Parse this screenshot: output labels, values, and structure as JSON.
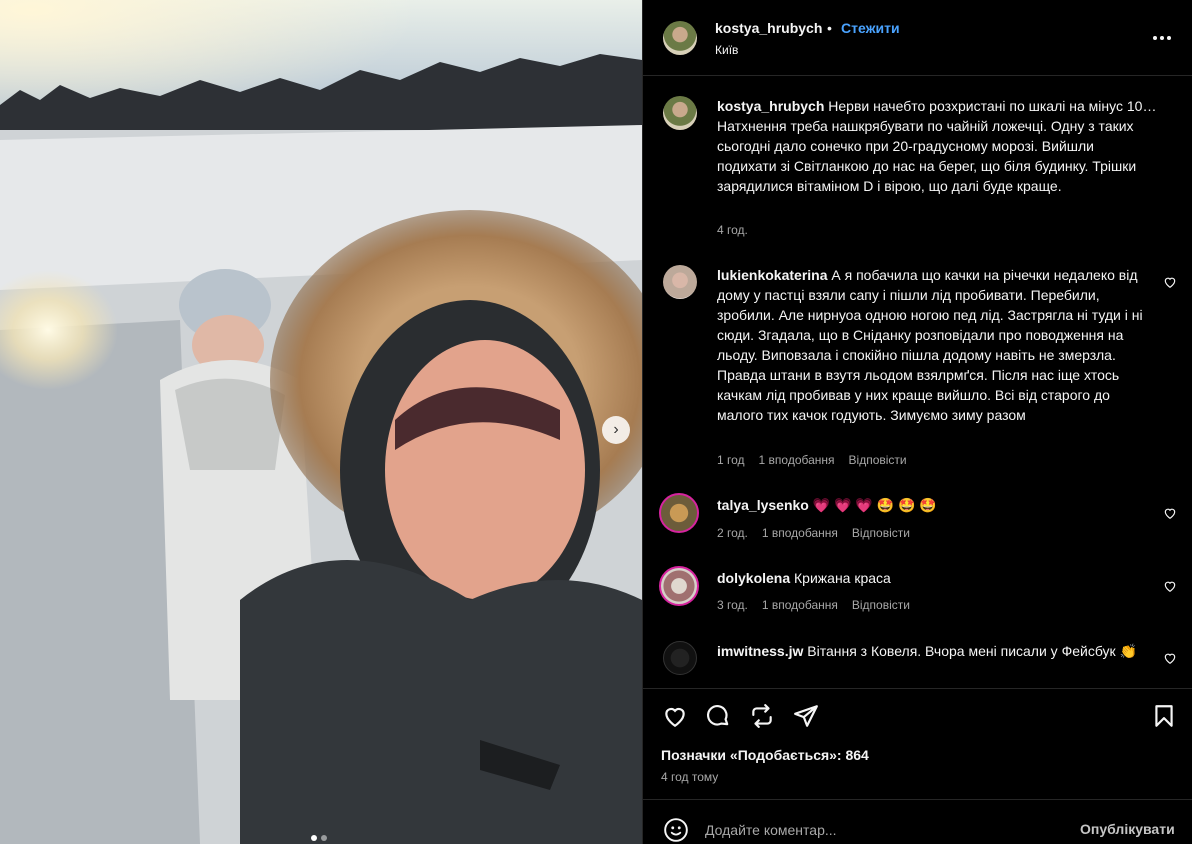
{
  "post": {
    "username": "kostya_hrubych",
    "separator": "•",
    "follow_label": "Стежити",
    "location": "Київ",
    "caption": "Нерви начебто розхристані по шкалі на мінус 10… Натхнення треба нашкрябувати по чайній ложечці. Одну з таких сьогодні дало сонечко при 20-градусному морозі. Вийшли подихати зі Світланкою до нас на берег, що біля будинку. Трішки зарядилися вітаміном D і вірою, що далі буде краще.",
    "caption_time": "4 год."
  },
  "comments": [
    {
      "username": "lukienkokaterina",
      "text": "А я побачила що качки на річечки недалеко від дому у пастці взяли сапу і пішли лід пробивати. Перебили, зробили. Але нирнуоа одною ногою пед лід. Застрягла ні туди і ні сюди. Згадала, що в Сніданку розповідали про поводження на льоду. Виповзала і спокійно пішла додому навіть не змерзла. Правда штани в взутя льодом взялрмґся. Після нас іще хтось качкам лід пробивав у них краще вийшло. Всі від старого до малого тих качок годують. Зимуємо зиму разом",
      "time": "1 год",
      "likes": "1 вподобання",
      "reply": "Відповісти"
    },
    {
      "username": "talya_lysenko",
      "text": "💗 💗 💗 🤩 🤩 🤩",
      "time": "2 год.",
      "likes": "1 вподобання",
      "reply": "Відповісти"
    },
    {
      "username": "dolykolena",
      "text": "Крижана краса",
      "time": "3 год.",
      "likes": "1 вподобання",
      "reply": "Відповісти"
    },
    {
      "username": "imwitness.jw",
      "text": "Вітання з Ковеля. Вчора мені писали у Фейсбук 👏",
      "time": "",
      "likes": "",
      "reply": ""
    }
  ],
  "footer": {
    "likes_text": "Позначки «Подобається»: 864",
    "time_ago": "4 год тому",
    "comment_placeholder": "Додайте коментар...",
    "post_label": "Опублікувати"
  },
  "colors": {
    "background": "#000000",
    "link_blue": "#4aa3ff",
    "meta_gray": "#a8a8a8"
  }
}
